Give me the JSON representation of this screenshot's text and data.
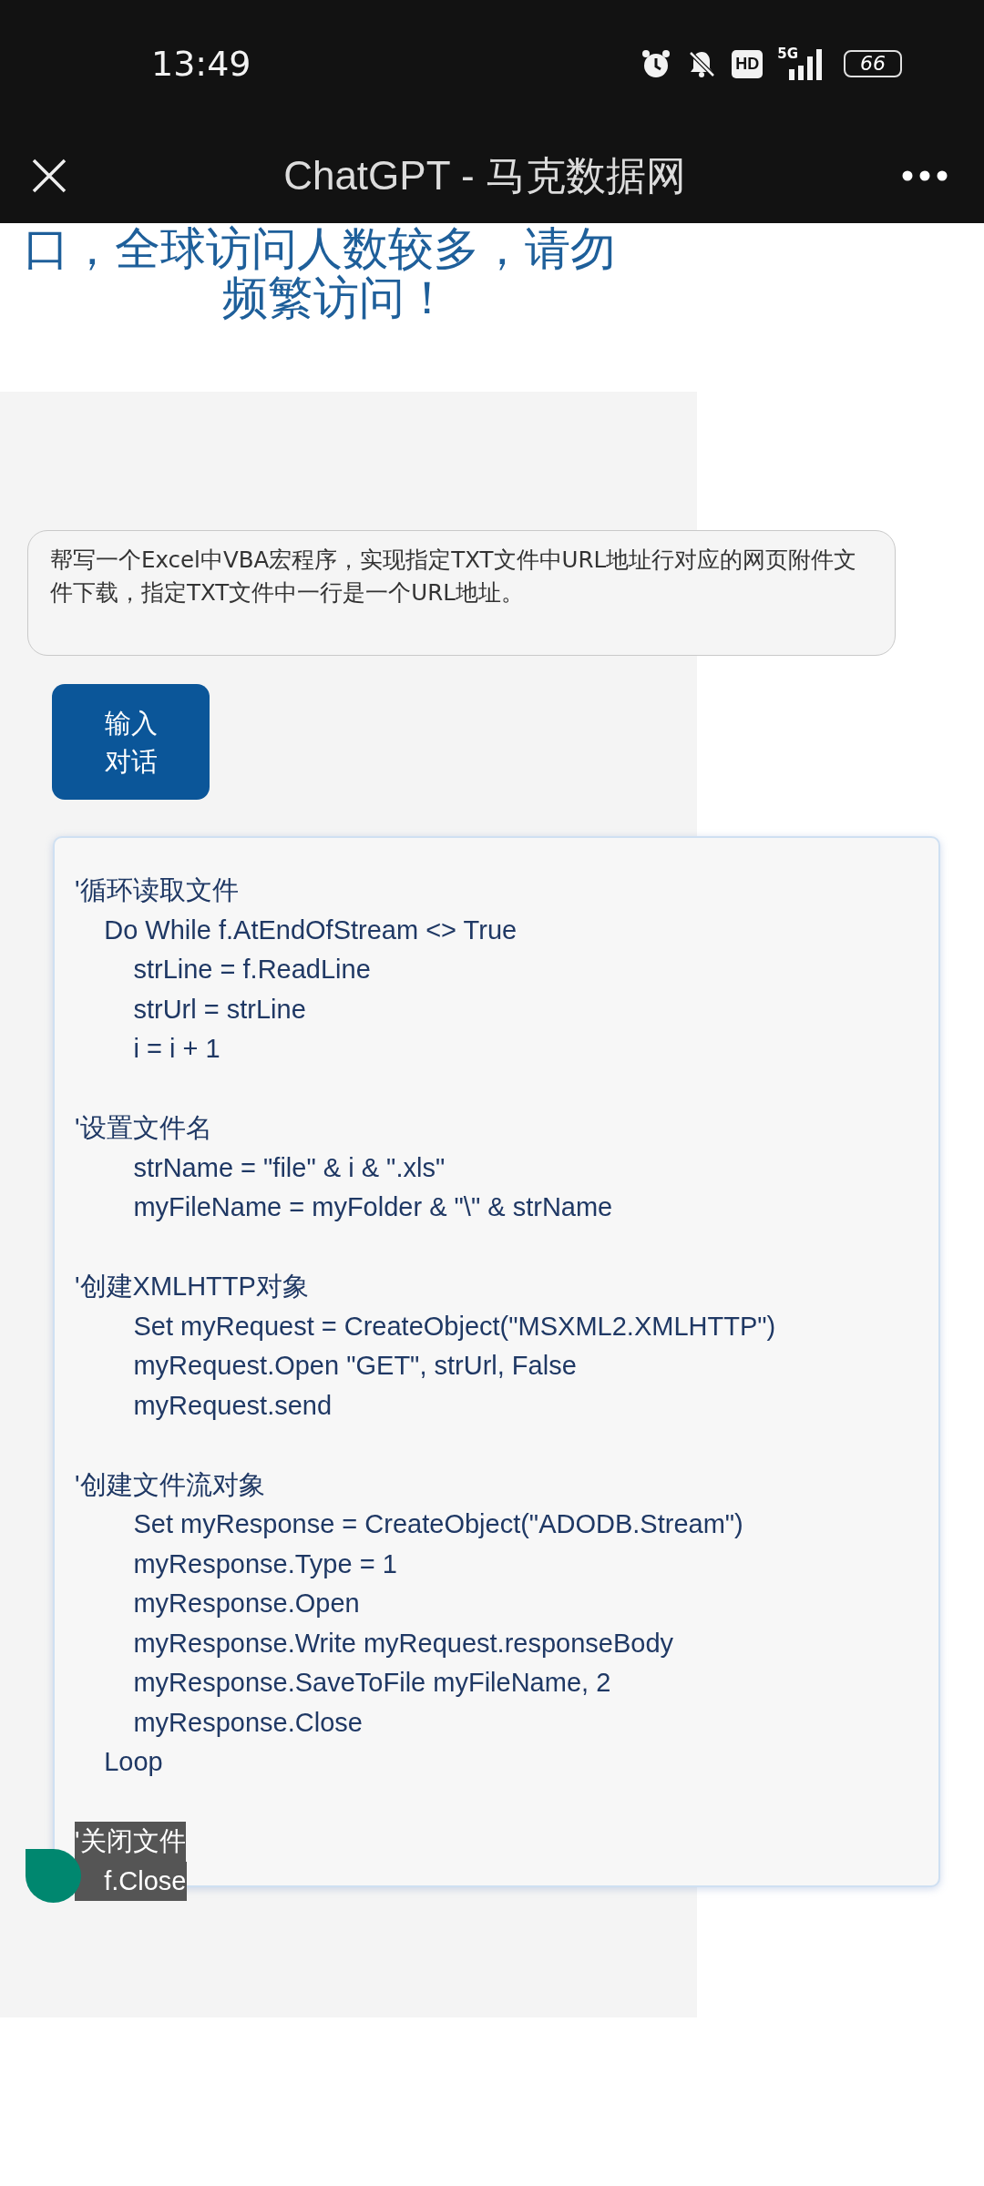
{
  "status_bar": {
    "time": "13:49",
    "hd_label": "HD",
    "network_label": "5G",
    "battery": "66"
  },
  "title_bar": {
    "title": "ChatGPT - 马克数据网"
  },
  "notice": {
    "lines": [
      "口，全球访问人数较多，请勿",
      "频繁访问！"
    ]
  },
  "prompt": {
    "value": "帮写一个Excel中VBA宏程序，实现指定TXT文件中URL地址行对应的网页附件文件下载，指定TXT文件中一行是一个URL地址。"
  },
  "send_button": {
    "lines": [
      "输入",
      "对话"
    ]
  },
  "code_blocks": [
    {
      "lines": [
        {
          "text": "'循环读取文件",
          "selected": false
        },
        {
          "text": "    Do While f.AtEndOfStream <> True",
          "selected": false
        },
        {
          "text": "        strLine = f.ReadLine",
          "selected": false
        },
        {
          "text": "        strUrl = strLine",
          "selected": false
        },
        {
          "text": "        i = i + 1",
          "selected": false
        }
      ]
    },
    {
      "lines": [
        {
          "text": "'设置文件名",
          "selected": false
        },
        {
          "text": "        strName = \"file\" & i & \".xls\"",
          "selected": false
        },
        {
          "text": "        myFileName = myFolder & \"\\\" & strName",
          "selected": false
        }
      ]
    },
    {
      "lines": [
        {
          "text": "'创建XMLHTTP对象",
          "selected": false
        },
        {
          "text": "        Set myRequest = CreateObject(\"MSXML2.XMLHTTP\")",
          "selected": false
        },
        {
          "text": "        myRequest.Open \"GET\", strUrl, False",
          "selected": false
        },
        {
          "text": "        myRequest.send",
          "selected": false
        }
      ]
    },
    {
      "lines": [
        {
          "text": "'创建文件流对象",
          "selected": false
        },
        {
          "text": "        Set myResponse = CreateObject(\"ADODB.Stream\")",
          "selected": false
        },
        {
          "text": "        myResponse.Type = 1",
          "selected": false
        },
        {
          "text": "        myResponse.Open",
          "selected": false
        },
        {
          "text": "        myResponse.Write myRequest.responseBody",
          "selected": false
        },
        {
          "text": "        myResponse.SaveToFile myFileName, 2",
          "selected": false
        },
        {
          "text": "        myResponse.Close",
          "selected": false
        },
        {
          "text": "    Loop",
          "selected": false
        }
      ]
    },
    {
      "lines": [
        {
          "text": "'关闭文件",
          "selected": true
        },
        {
          "text": "    f.Close",
          "selected": true
        }
      ]
    }
  ]
}
